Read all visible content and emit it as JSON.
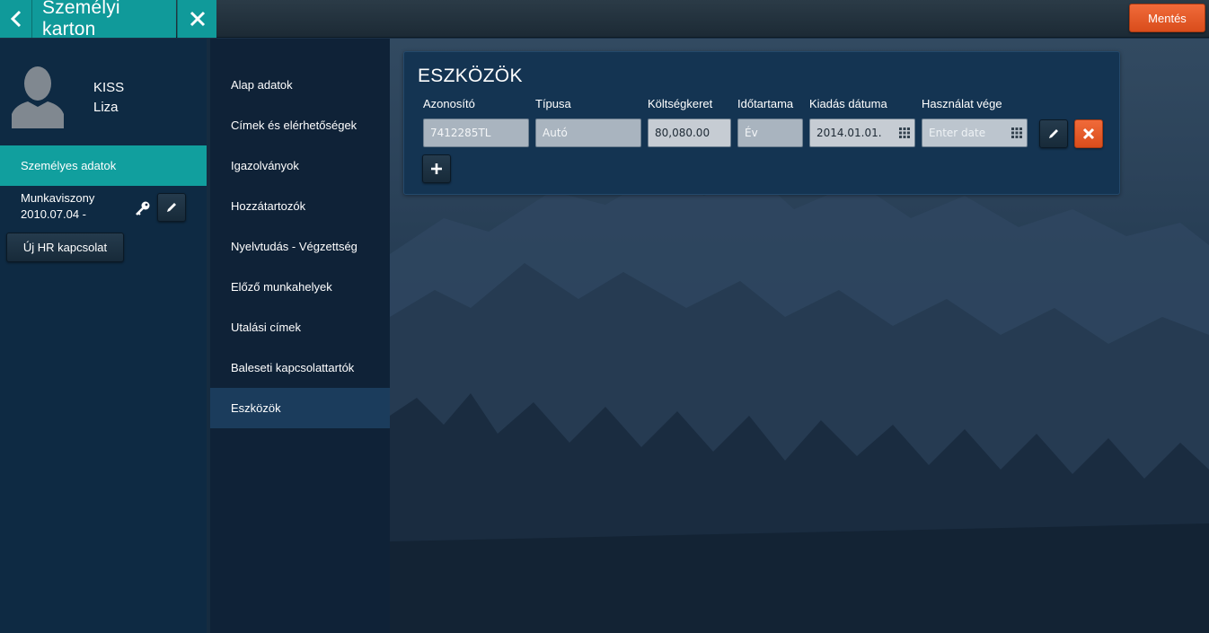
{
  "topbar": {
    "title": "Személyi karton",
    "save_label": "Mentés",
    "back_icon": "chevron-left-icon",
    "close_icon": "close-icon"
  },
  "profile": {
    "last_name": "KISS",
    "first_name": "Liza"
  },
  "left_menu": {
    "active_label": "Személyes adatok",
    "employment_label": "Munkaviszony",
    "employment_date": "2010.07.04 -",
    "new_hr_label": "Új HR kapcsolat"
  },
  "nav": {
    "items": [
      "Alap adatok",
      "Címek és elérhetőségek",
      "Igazolványok",
      "Hozzátartozók",
      "Nyelvtudás - Végzettség",
      "Előző munkahelyek",
      "Utalási címek",
      "Baleseti kapcsolattartók",
      "Eszközök"
    ],
    "active_index": 8
  },
  "assets": {
    "title": "ESZKÖZÖK",
    "headers": [
      "Azonosító",
      "Típusa",
      "Költségkeret",
      "Időtartama",
      "Kiadás dátuma",
      "Használat vége"
    ],
    "row": {
      "id": "7412285TL",
      "type": "Autó",
      "budget": "80,080.00",
      "duration": "Év",
      "issue_date": "2014.01.01.",
      "end_date_placeholder": "Enter date"
    }
  },
  "colors": {
    "teal": "#109a9a",
    "accent_orange": "#e45a28",
    "panel": "#0e2a43",
    "card": "#143452"
  }
}
